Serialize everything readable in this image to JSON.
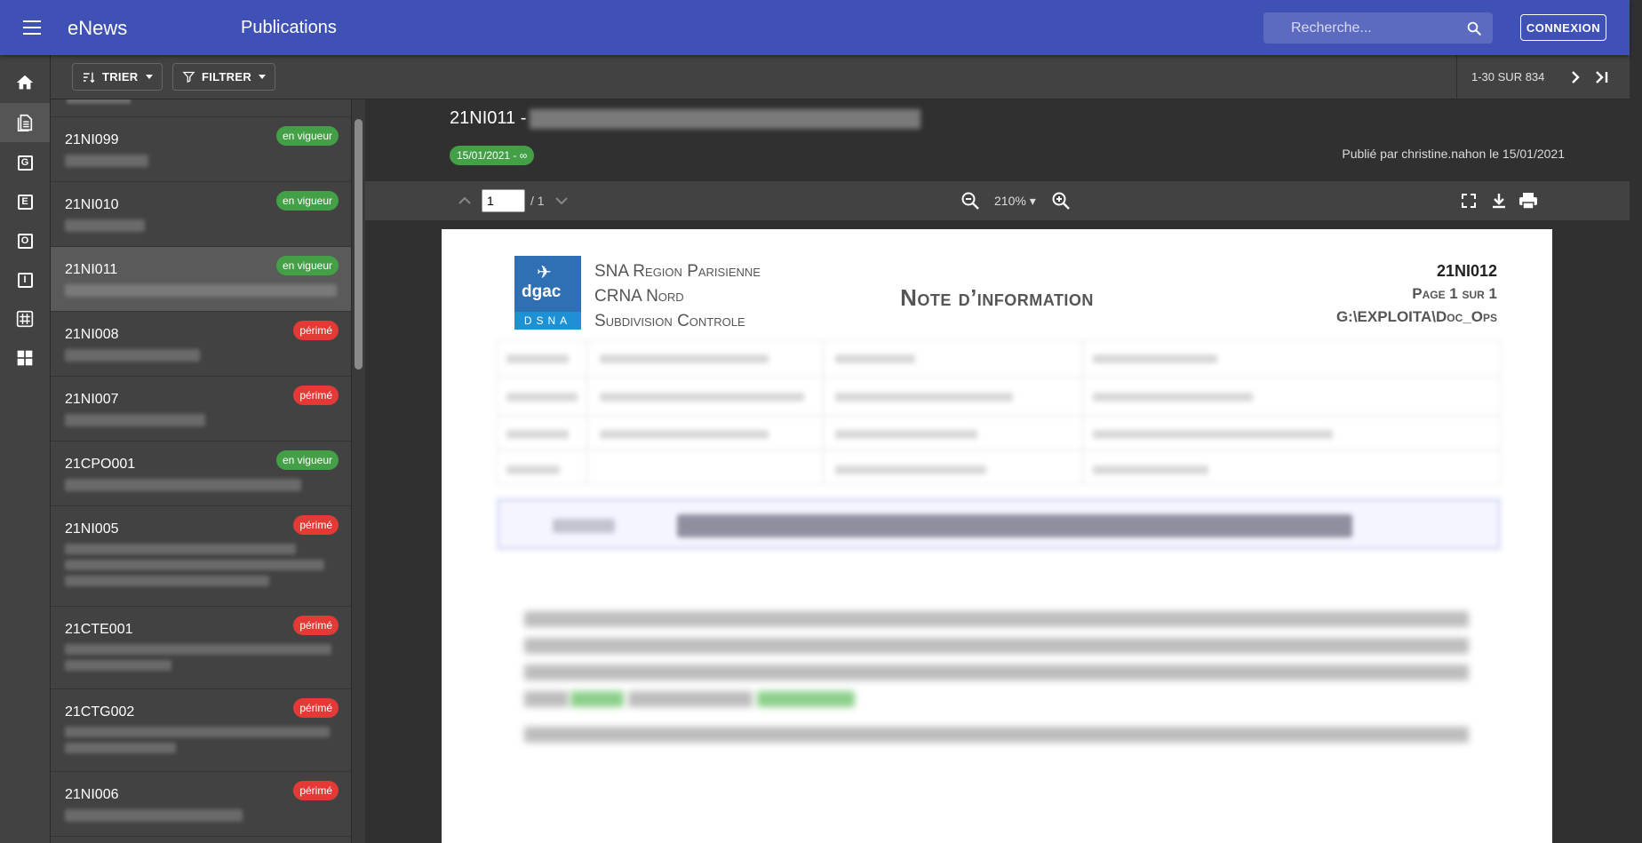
{
  "appbar": {
    "app_name": "eNews",
    "page_title": "Publications",
    "search_placeholder": "Recherche...",
    "login_label": "CONNEXION",
    "color": "#3f51b5"
  },
  "rail": {
    "items": [
      {
        "name": "home",
        "icon": "home-icon"
      },
      {
        "name": "publications",
        "icon": "document-icon",
        "active": true
      },
      {
        "name": "g",
        "letter": "G"
      },
      {
        "name": "e",
        "letter": "E"
      },
      {
        "name": "o",
        "letter": "O"
      },
      {
        "name": "i",
        "letter": "I"
      },
      {
        "name": "hash",
        "icon": "hash-icon"
      },
      {
        "name": "dashboard",
        "icon": "dashboard-icon"
      }
    ]
  },
  "toolbar": {
    "sort_label": "TRIER",
    "filter_label": "FILTRER",
    "pager_text": "1-30 SUR 834"
  },
  "list": {
    "items": [
      {
        "code": "21NI099",
        "status": "en vigueur"
      },
      {
        "code": "21NI010",
        "status": "en vigueur"
      },
      {
        "code": "21NI011",
        "status": "en vigueur",
        "selected": true
      },
      {
        "code": "21NI008",
        "status": "périmé"
      },
      {
        "code": "21NI007",
        "status": "périmé"
      },
      {
        "code": "21CPO001",
        "status": "en vigueur"
      },
      {
        "code": "21NI005",
        "status": "périmé"
      },
      {
        "code": "21CTE001",
        "status": "périmé"
      },
      {
        "code": "21CTG002",
        "status": "périmé"
      },
      {
        "code": "21NI006",
        "status": "périmé"
      }
    ],
    "status_colors": {
      "en vigueur": "#43a047",
      "périmé": "#e53935"
    }
  },
  "document": {
    "title_prefix": "21NI011 -",
    "date_chip": "15/01/2021 - ∞",
    "published": "Publié par christine.nahon le 15/01/2021"
  },
  "viewer": {
    "page_value": "1",
    "page_total": "/ 1",
    "zoom": "210%"
  },
  "pdf": {
    "logo_text": "dgac",
    "logo_subtext": "DSNA",
    "org_lines": [
      "SNA Region Parisienne",
      "CRNA Nord",
      "Subdivision Controle"
    ],
    "doc_type": "Note d’information",
    "ref_code": "21NI012",
    "ref_page": "Page 1 sur 1",
    "ref_path": "G:\\EXPLOITA\\Doc_Ops"
  }
}
